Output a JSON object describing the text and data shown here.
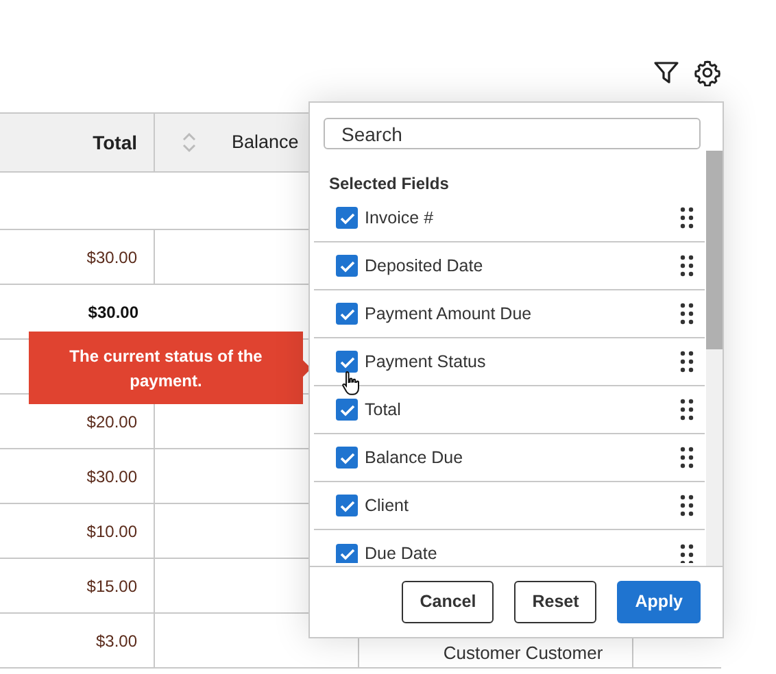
{
  "table": {
    "columns": [
      {
        "label": "Total",
        "sortable": false
      },
      {
        "label": "Balance",
        "sortable": true
      }
    ],
    "rows": [
      {},
      {
        "total": "$30.00"
      },
      {
        "total": "$30.00",
        "kind": "subtotal"
      },
      {},
      {
        "total": "$20.00"
      },
      {
        "total": "$30.00"
      },
      {
        "total": "$10.00"
      },
      {
        "total": "$15.00"
      },
      {
        "total": "$3.00",
        "column_3": "Customer Customer"
      }
    ]
  },
  "tooltip": {
    "text": "The current status of the payment."
  },
  "field_chooser": {
    "search": {
      "placeholder": "Search"
    },
    "heading": "Selected Fields",
    "fields": [
      {
        "label": "Invoice #",
        "checked": true
      },
      {
        "label": "Deposited Date",
        "checked": true
      },
      {
        "label": "Payment Amount Due",
        "checked": true
      },
      {
        "label": "Payment Status",
        "checked": true
      },
      {
        "label": "Total",
        "checked": true
      },
      {
        "label": "Balance Due",
        "checked": true
      },
      {
        "label": "Client",
        "checked": true
      },
      {
        "label": "Due Date",
        "checked": true
      }
    ],
    "buttons": [
      {
        "label": "Cancel",
        "kind": "secondary"
      },
      {
        "label": "Reset",
        "kind": "secondary"
      },
      {
        "label": "Apply",
        "kind": "primary"
      }
    ]
  }
}
